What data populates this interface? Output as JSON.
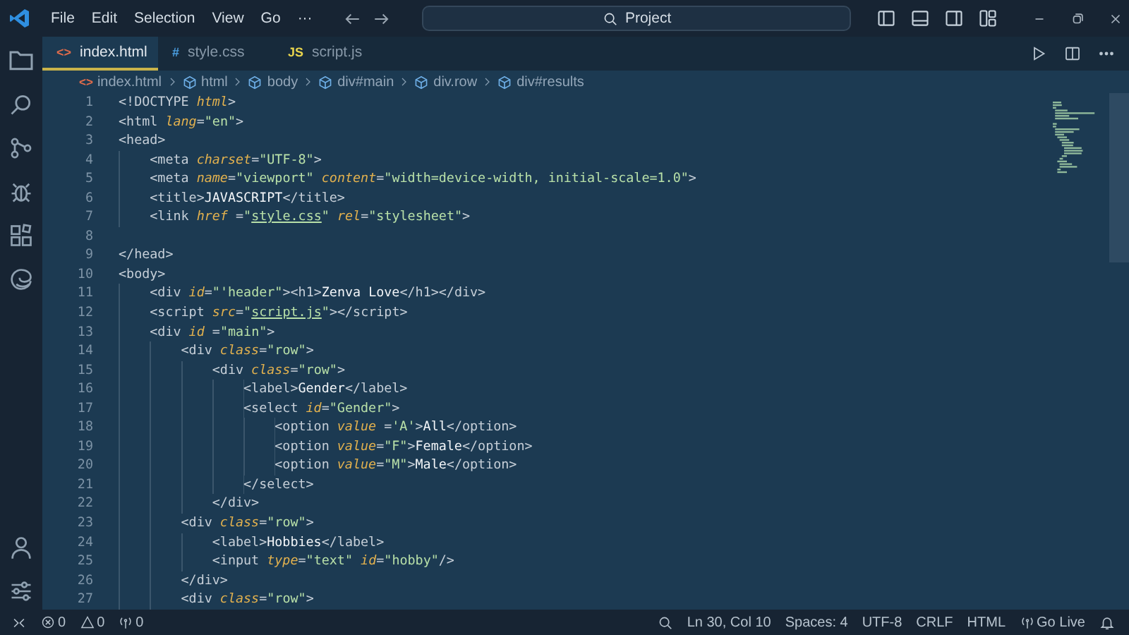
{
  "title_bar": {
    "menus": [
      "File",
      "Edit",
      "Selection",
      "View",
      "Go",
      "···"
    ],
    "command_center": "Project"
  },
  "activity_bar": {
    "top": [
      {
        "kind": "explorer"
      },
      {
        "kind": "search"
      },
      {
        "kind": "scm"
      },
      {
        "kind": "debug"
      },
      {
        "kind": "extensions"
      },
      {
        "kind": "browser"
      }
    ],
    "bottom": [
      {
        "kind": "account"
      },
      {
        "kind": "manage"
      }
    ]
  },
  "tabs": [
    {
      "icon": "<>",
      "label": "index.html",
      "selected": true,
      "color": "#e06c4b"
    },
    {
      "icon": "#",
      "label": "style.css",
      "selected": false,
      "color": "#4a9ee0"
    },
    {
      "icon": "JS",
      "label": "script.js",
      "selected": false,
      "color": "#e8d44d"
    }
  ],
  "breadcrumbs": [
    {
      "kind": "file",
      "icon": "<>",
      "label": "index.html"
    },
    {
      "kind": "element",
      "label": "html"
    },
    {
      "kind": "element",
      "label": "body"
    },
    {
      "kind": "element",
      "label": "div#main"
    },
    {
      "kind": "element",
      "label": "div.row"
    },
    {
      "kind": "element",
      "label": "div#results"
    }
  ],
  "editor": {
    "lines": [
      {
        "number": "1",
        "tokens": [
          {
            "kind": "tag",
            "text": "<!DOCTYPE "
          },
          {
            "kind": "attr",
            "text": "html"
          },
          {
            "kind": "tag",
            "text": ">"
          }
        ]
      },
      {
        "number": "2",
        "tokens": [
          {
            "kind": "tag",
            "text": "<html "
          },
          {
            "kind": "attr",
            "text": "lang"
          },
          {
            "kind": "tag",
            "text": "="
          },
          {
            "kind": "str",
            "text": "\"en\""
          },
          {
            "kind": "tag",
            "text": ">"
          }
        ]
      },
      {
        "number": "3",
        "tokens": [
          {
            "kind": "tag",
            "text": "<head>"
          }
        ]
      },
      {
        "number": "4",
        "tokens": [
          {
            "kind": "tag",
            "text": "    <meta "
          },
          {
            "kind": "attr",
            "text": "charset"
          },
          {
            "kind": "tag",
            "text": "="
          },
          {
            "kind": "str",
            "text": "\"UTF-8\""
          },
          {
            "kind": "tag",
            "text": ">"
          }
        ]
      },
      {
        "number": "5",
        "tokens": [
          {
            "kind": "tag",
            "text": "    <meta "
          },
          {
            "kind": "attr",
            "text": "name"
          },
          {
            "kind": "tag",
            "text": "="
          },
          {
            "kind": "str",
            "text": "\"viewport\""
          },
          {
            "kind": "attr",
            "text": " content"
          },
          {
            "kind": "tag",
            "text": "="
          },
          {
            "kind": "str",
            "text": "\"width=device-width, initial-scale=1.0\""
          },
          {
            "kind": "tag",
            "text": ">"
          }
        ]
      },
      {
        "number": "6",
        "tokens": [
          {
            "kind": "tag",
            "text": "    <title>"
          },
          {
            "kind": "text",
            "text": "JAVASCRIPT"
          },
          {
            "kind": "tag",
            "text": "</title>"
          }
        ]
      },
      {
        "number": "7",
        "tokens": [
          {
            "kind": "tag",
            "text": "    <link "
          },
          {
            "kind": "attr",
            "text": "href"
          },
          {
            "kind": "tag",
            "text": " ="
          },
          {
            "kind": "str",
            "text": "\""
          },
          {
            "kind": "link",
            "text": "style.css"
          },
          {
            "kind": "str",
            "text": "\""
          },
          {
            "kind": "attr",
            "text": " rel"
          },
          {
            "kind": "tag",
            "text": "="
          },
          {
            "kind": "str",
            "text": "\"stylesheet\""
          },
          {
            "kind": "tag",
            "text": ">"
          }
        ]
      },
      {
        "number": "8"
      },
      {
        "number": "9",
        "tokens": [
          {
            "kind": "tag",
            "text": "</head>"
          }
        ]
      },
      {
        "number": "10",
        "tokens": [
          {
            "kind": "tag",
            "text": "<body>"
          }
        ]
      },
      {
        "number": "11",
        "tokens": [
          {
            "kind": "tag",
            "text": "    <div "
          },
          {
            "kind": "attr",
            "text": "id"
          },
          {
            "kind": "tag",
            "text": "="
          },
          {
            "kind": "str",
            "text": "\"'header\""
          },
          {
            "kind": "tag",
            "text": "><h1>"
          },
          {
            "kind": "text",
            "text": "Zenva Love"
          },
          {
            "kind": "tag",
            "text": "</h1></div>"
          }
        ]
      },
      {
        "number": "12",
        "tokens": [
          {
            "kind": "tag",
            "text": "    <script "
          },
          {
            "kind": "attr",
            "text": "src"
          },
          {
            "kind": "tag",
            "text": "="
          },
          {
            "kind": "str",
            "text": "\""
          },
          {
            "kind": "link",
            "text": "script.js"
          },
          {
            "kind": "str",
            "text": "\""
          },
          {
            "kind": "tag",
            "text": "></script>"
          }
        ]
      },
      {
        "number": "13",
        "tokens": [
          {
            "kind": "tag",
            "text": "    <div "
          },
          {
            "kind": "attr",
            "text": "id"
          },
          {
            "kind": "tag",
            "text": " ="
          },
          {
            "kind": "str",
            "text": "\"main\""
          },
          {
            "kind": "tag",
            "text": ">"
          }
        ]
      },
      {
        "number": "14",
        "tokens": [
          {
            "kind": "tag",
            "text": "        <div "
          },
          {
            "kind": "attr",
            "text": "class"
          },
          {
            "kind": "tag",
            "text": "="
          },
          {
            "kind": "str",
            "text": "\"row\""
          },
          {
            "kind": "tag",
            "text": ">"
          }
        ]
      },
      {
        "number": "15",
        "tokens": [
          {
            "kind": "tag",
            "text": "            <div "
          },
          {
            "kind": "attr",
            "text": "class"
          },
          {
            "kind": "tag",
            "text": "="
          },
          {
            "kind": "str",
            "text": "\"row\""
          },
          {
            "kind": "tag",
            "text": ">"
          }
        ]
      },
      {
        "number": "16",
        "tokens": [
          {
            "kind": "tag",
            "text": "                <label>"
          },
          {
            "kind": "text",
            "text": "Gender"
          },
          {
            "kind": "tag",
            "text": "</label>"
          }
        ]
      },
      {
        "number": "17",
        "tokens": [
          {
            "kind": "tag",
            "text": "                <select "
          },
          {
            "kind": "attr",
            "text": "id"
          },
          {
            "kind": "tag",
            "text": "="
          },
          {
            "kind": "str",
            "text": "\"Gender\""
          },
          {
            "kind": "tag",
            "text": ">"
          }
        ]
      },
      {
        "number": "18",
        "tokens": [
          {
            "kind": "tag",
            "text": "                    <option "
          },
          {
            "kind": "attr",
            "text": "value"
          },
          {
            "kind": "tag",
            "text": " ="
          },
          {
            "kind": "str",
            "text": "'A'"
          },
          {
            "kind": "tag",
            "text": ">"
          },
          {
            "kind": "text",
            "text": "All"
          },
          {
            "kind": "tag",
            "text": "</option>"
          }
        ]
      },
      {
        "number": "19",
        "tokens": [
          {
            "kind": "tag",
            "text": "                    <option "
          },
          {
            "kind": "attr",
            "text": "value"
          },
          {
            "kind": "tag",
            "text": "="
          },
          {
            "kind": "str",
            "text": "\"F\""
          },
          {
            "kind": "tag",
            "text": ">"
          },
          {
            "kind": "text",
            "text": "Female"
          },
          {
            "kind": "tag",
            "text": "</option>"
          }
        ]
      },
      {
        "number": "20",
        "tokens": [
          {
            "kind": "tag",
            "text": "                    <option "
          },
          {
            "kind": "attr",
            "text": "value"
          },
          {
            "kind": "tag",
            "text": "="
          },
          {
            "kind": "str",
            "text": "\"M\""
          },
          {
            "kind": "tag",
            "text": ">"
          },
          {
            "kind": "text",
            "text": "Male"
          },
          {
            "kind": "tag",
            "text": "</option>"
          }
        ]
      },
      {
        "number": "21",
        "tokens": [
          {
            "kind": "tag",
            "text": "                </select>"
          }
        ]
      },
      {
        "number": "22",
        "tokens": [
          {
            "kind": "tag",
            "text": "            </div>"
          }
        ]
      },
      {
        "number": "23",
        "tokens": [
          {
            "kind": "tag",
            "text": "        <div "
          },
          {
            "kind": "attr",
            "text": "class"
          },
          {
            "kind": "tag",
            "text": "="
          },
          {
            "kind": "str",
            "text": "\"row\""
          },
          {
            "kind": "tag",
            "text": ">"
          }
        ]
      },
      {
        "number": "24",
        "tokens": [
          {
            "kind": "tag",
            "text": "            <label>"
          },
          {
            "kind": "text",
            "text": "Hobbies"
          },
          {
            "kind": "tag",
            "text": "</label>"
          }
        ]
      },
      {
        "number": "25",
        "tokens": [
          {
            "kind": "tag",
            "text": "            <input "
          },
          {
            "kind": "attr",
            "text": "type"
          },
          {
            "kind": "tag",
            "text": "="
          },
          {
            "kind": "str",
            "text": "\"text\""
          },
          {
            "kind": "attr",
            "text": " id"
          },
          {
            "kind": "tag",
            "text": "="
          },
          {
            "kind": "str",
            "text": "\"hobby\""
          },
          {
            "kind": "tag",
            "text": "/>"
          }
        ]
      },
      {
        "number": "26",
        "tokens": [
          {
            "kind": "tag",
            "text": "        </div>"
          }
        ]
      },
      {
        "number": "27",
        "tokens": [
          {
            "kind": "tag",
            "text": "        <div "
          },
          {
            "kind": "attr",
            "text": "class"
          },
          {
            "kind": "tag",
            "text": "="
          },
          {
            "kind": "str",
            "text": "\"row\""
          },
          {
            "kind": "tag",
            "text": ">"
          }
        ]
      }
    ]
  },
  "status_bar": {
    "left": [
      {
        "kind": "remote"
      },
      {
        "kind": "errors",
        "text": "0"
      },
      {
        "kind": "warnings",
        "text": "0"
      },
      {
        "kind": "ports",
        "text": "0"
      }
    ],
    "right": [
      {
        "kind": "zoom"
      },
      {
        "kind": "text",
        "text": "Ln 30, Col 10"
      },
      {
        "kind": "text",
        "text": "Spaces: 4"
      },
      {
        "kind": "text",
        "text": "UTF-8"
      },
      {
        "kind": "text",
        "text": "CRLF"
      },
      {
        "kind": "text",
        "text": "HTML"
      },
      {
        "kind": "live",
        "text": "Go Live"
      },
      {
        "kind": "bell"
      }
    ]
  }
}
